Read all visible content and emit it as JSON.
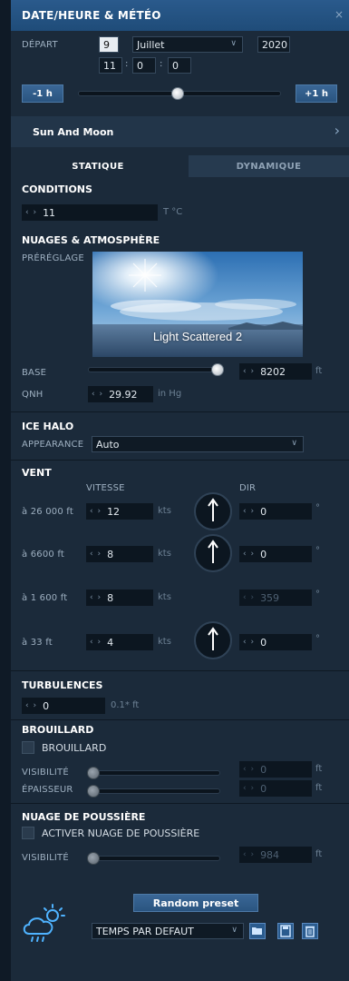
{
  "header": {
    "title": "DATE/HEURE & MÉTÉO",
    "close": "×"
  },
  "date": {
    "label": "DÉPART",
    "day": "9",
    "month": "Juillet",
    "year": "2020",
    "hour": "11",
    "minute": "0",
    "second": "0",
    "sep": ":",
    "minus_label": "-1 h",
    "plus_label": "+1 h",
    "time_slider": 0.49
  },
  "sun_and_moon": {
    "label": "Sun And Moon"
  },
  "tabs": [
    {
      "label": "STATIQUE",
      "active": true
    },
    {
      "label": "DYNAMIQUE",
      "active": false
    }
  ],
  "conditions": {
    "title": "CONDITIONS",
    "temperature": "11",
    "temperature_unit": "T °C"
  },
  "clouds": {
    "title": "NUAGES & ATMOSPHÈRE",
    "preset_label": "PRÉRÉGLAGE",
    "preset_name": "Light Scattered 2",
    "base_label": "BASE",
    "base_value": "8202",
    "base_unit": "ft",
    "base_slider": 0.95,
    "qnh_label": "QNH",
    "qnh_value": "29.92",
    "qnh_unit": "in Hg"
  },
  "ice_halo": {
    "title": "ICE HALO",
    "appearance_label": "APPEARANCE",
    "appearance_value": "Auto"
  },
  "wind": {
    "title": "VENT",
    "speed_header": "VITESSE",
    "dir_header": "DIR",
    "speed_unit": "kts",
    "dir_unit": "°",
    "rows": [
      {
        "altitude": "à 26 000 ft",
        "speed": "12",
        "dir": "0",
        "enabled": true
      },
      {
        "altitude": "à 6600 ft",
        "speed": "8",
        "dir": "0",
        "enabled": true
      },
      {
        "altitude": "à 1 600 ft",
        "speed": "8",
        "dir": "359",
        "enabled": false
      },
      {
        "altitude": "à 33 ft",
        "speed": "4",
        "dir": "0",
        "enabled": true
      }
    ]
  },
  "turbulence": {
    "title": "TURBULENCES",
    "value": "0",
    "unit": "0.1* ft"
  },
  "fog": {
    "title": "BROUILLARD",
    "checkbox_label": "BROUILLARD",
    "visibility_label": "VISIBILITÉ",
    "visibility_value": "0",
    "thickness_label": "ÉPAISSEUR",
    "thickness_value": "0",
    "unit": "ft"
  },
  "dust": {
    "title": "NUAGE DE POUSSIÈRE",
    "checkbox_label": "ACTIVER NUAGE DE POUSSIÈRE",
    "visibility_label": "VISIBILITÉ",
    "visibility_value": "984",
    "unit": "ft"
  },
  "footer": {
    "random_label": "Random preset",
    "weather_preset": "TEMPS PAR DEFAUT"
  },
  "colors": {
    "header": "#2a5a8c",
    "panel": "#1b2a3a",
    "accent": "#3a6796"
  }
}
